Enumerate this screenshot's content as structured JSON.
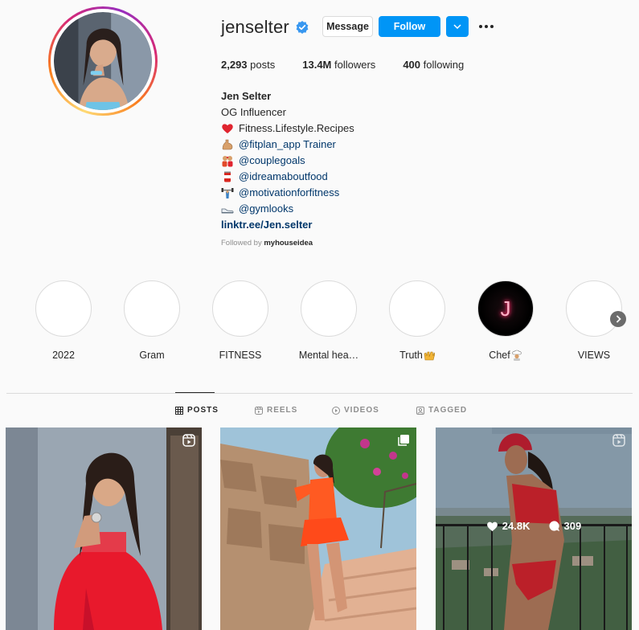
{
  "profile": {
    "username": "jenselter",
    "verified": true,
    "buttons": {
      "message": "Message",
      "follow": "Follow"
    },
    "stats": {
      "posts_count": "2,293",
      "posts_label": "posts",
      "followers_count": "13.4M",
      "followers_label": "followers",
      "following_count": "400",
      "following_label": "following"
    },
    "bio": {
      "name": "Jen Selter",
      "tagline": "OG Influencer",
      "lines": [
        {
          "icon": "red-heart-icon",
          "text": "Fitness.Lifestyle.Recipes"
        },
        {
          "icon": "flexed-biceps-icon",
          "text": "@fitplan_app Trainer"
        },
        {
          "icon": "couple-icon",
          "text": "@couplegoals"
        },
        {
          "icon": "food-can-icon",
          "text": "@idreamaboutfood"
        },
        {
          "icon": "weightlifter-icon",
          "text": "@motivationforfitness"
        },
        {
          "icon": "sneaker-icon",
          "text": "@gymlooks"
        }
      ],
      "link": "linktr.ee/Jen.selter"
    },
    "followed_by": {
      "prefix": "Followed by",
      "user": "myhouseidea"
    }
  },
  "highlights": [
    {
      "label": "2022",
      "emoji": ""
    },
    {
      "label": "Gram",
      "emoji": ""
    },
    {
      "label": "FITNESS",
      "emoji": ""
    },
    {
      "label": "Mental hea…",
      "emoji": ""
    },
    {
      "label": "Truth",
      "emoji": "raising-hands-icon"
    },
    {
      "label": "Chef",
      "emoji": "cook-icon"
    },
    {
      "label": "VIEWS",
      "emoji": ""
    }
  ],
  "highlight_chef_letter": "J",
  "tabs": [
    {
      "label": "POSTS",
      "icon": "grid-icon",
      "active": true
    },
    {
      "label": "REELS",
      "icon": "reels-icon",
      "active": false
    },
    {
      "label": "VIDEOS",
      "icon": "play-icon",
      "active": false
    },
    {
      "label": "TAGGED",
      "icon": "tag-icon",
      "active": false
    }
  ],
  "posts": [
    {
      "type_icon": "reel-icon"
    },
    {
      "type_icon": "carousel-icon"
    },
    {
      "type_icon": "reel-icon",
      "likes": "24.8K",
      "comments": "309"
    }
  ],
  "colors": {
    "accent": "#0095f6",
    "text": "#262626",
    "muted": "#8e8e8e",
    "link": "#00376b"
  }
}
